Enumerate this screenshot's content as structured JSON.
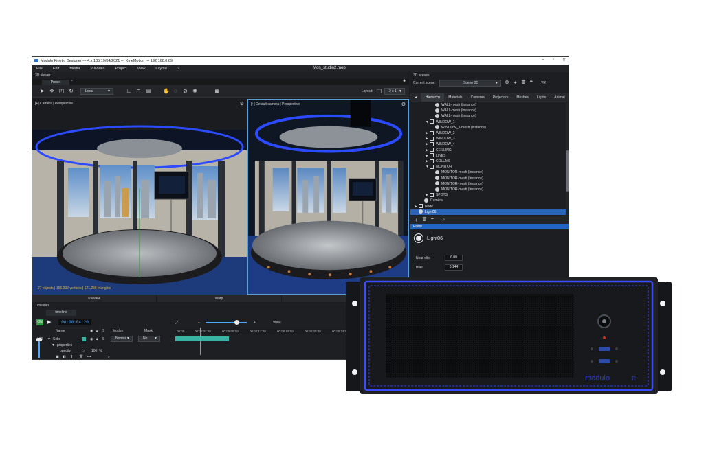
{
  "window": {
    "title": "Modulo Kinetic Designer --- 4.x.105 19/04/2021 --- KineMotion --- 192.168.0.69",
    "document": "Mon_studio2.mop"
  },
  "menu": [
    "File",
    "Edit",
    "Media",
    "V-Nodes",
    "Project",
    "View",
    "Layout",
    "?"
  ],
  "viewer": {
    "panel_title": "3D viewer",
    "tab": "Preset",
    "coord_mode": "Local",
    "layout_label": "Layout:",
    "layout_value": "2 x 1",
    "left_label": "[+] Caméra | Perspective",
    "right_label": "[+] Default camera | Perspective",
    "stats": "27 objects | 156,392 vertices | 121,256 triangles",
    "bottom_tabs": [
      "Preview",
      "Warp",
      "3D sc"
    ]
  },
  "timelines": {
    "panel_title": "Timelines",
    "tab": "timeline",
    "on_label": "ON",
    "time": "00:00:04:20",
    "headers": {
      "name": "Name",
      "s": "S",
      "modes": "Modes",
      "mask": "Mask"
    },
    "view_label": "View:",
    "row_solid": {
      "level": "100",
      "name": "Solid",
      "s": "S",
      "mode": "Normal",
      "mask": "No"
    },
    "row_properties": "properties",
    "row_opacity": {
      "name": "opacity",
      "value": "100",
      "unit": "%"
    },
    "ruler": [
      "00:00",
      "00:00:04:00",
      "00:00:08:00",
      "00:00:12:00",
      "00:00:16:00",
      "00:00:20:00",
      "00:00:24:00",
      "00:00:28:00",
      "00:00:3"
    ]
  },
  "scenes": {
    "panel_title": "3D scenes",
    "current_label": "Current scene:",
    "current_value": "Scene 3D",
    "vr_label": "VR",
    "tabs": [
      "Hierarchy",
      "Materials",
      "Cameras",
      "Projectors",
      "Meshes",
      "Lights",
      "Animat"
    ],
    "tree": [
      {
        "indent": 3,
        "type": "mesh",
        "label": "WALL-mesh (instance)"
      },
      {
        "indent": 3,
        "type": "mesh",
        "label": "WALL-mesh (instance)"
      },
      {
        "indent": 3,
        "type": "mesh",
        "label": "WALL-mesh (instance)"
      },
      {
        "indent": 2,
        "type": "node",
        "arrow": "▼",
        "label": "WINDOW_1"
      },
      {
        "indent": 3,
        "type": "mesh",
        "label": "WINDOW_1-mesh (instance)"
      },
      {
        "indent": 2,
        "type": "node",
        "arrow": "▶",
        "label": "WINDOW_2"
      },
      {
        "indent": 2,
        "type": "node",
        "arrow": "▶",
        "label": "WINDOW_3"
      },
      {
        "indent": 2,
        "type": "node",
        "arrow": "▶",
        "label": "WINDOW_4"
      },
      {
        "indent": 2,
        "type": "node",
        "arrow": "▶",
        "label": "CEILLING"
      },
      {
        "indent": 2,
        "type": "node",
        "arrow": "▶",
        "label": "LINES"
      },
      {
        "indent": 2,
        "type": "node",
        "arrow": "▶",
        "label": "COLUMS"
      },
      {
        "indent": 2,
        "type": "node",
        "arrow": "▼",
        "label": "MONITOR"
      },
      {
        "indent": 3,
        "type": "mesh",
        "label": "MONITOR-mesh (instance)"
      },
      {
        "indent": 3,
        "type": "mesh",
        "label": "MONITOR-mesh (instance)"
      },
      {
        "indent": 3,
        "type": "mesh",
        "label": "MONITOR-mesh (instance)"
      },
      {
        "indent": 3,
        "type": "mesh",
        "label": "MONITOR-mesh (instance)"
      },
      {
        "indent": 2,
        "type": "node",
        "arrow": "▶",
        "label": "SPOTS"
      },
      {
        "indent": 1,
        "type": "camera",
        "label": "Caméra"
      },
      {
        "indent": 0,
        "type": "node",
        "arrow": "▶",
        "label": "Node"
      },
      {
        "indent": 0,
        "type": "light",
        "label": "Light06",
        "selected": true
      }
    ],
    "editor_title": "Editor",
    "light_name": "Light06",
    "near_clip_label": "Near clip:",
    "near_clip_value": "6.00",
    "bias_label": "Bias:",
    "bias_value": "0.144"
  },
  "hardware": {
    "brand": "modulo",
    "brand_mark": "π"
  },
  "colors": {
    "accent_blue": "#1f66c2",
    "timeline_teal": "#3bb3a4",
    "stats_yellow": "#e0b43c",
    "led_blue": "#3a4cff"
  }
}
